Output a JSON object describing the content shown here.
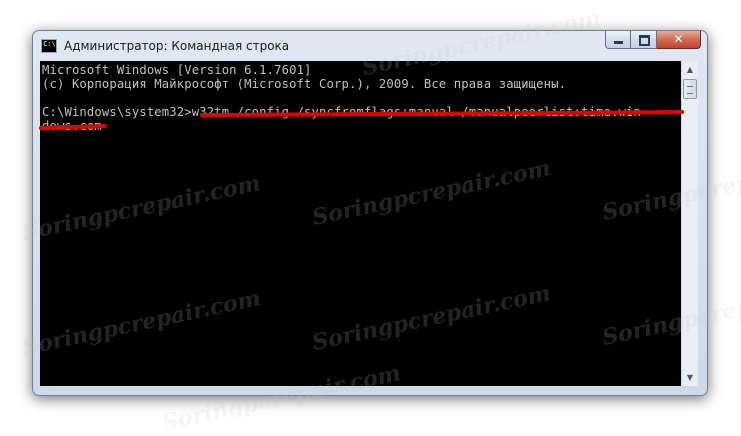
{
  "window": {
    "title": "Администратор: Командная строка",
    "icon_glyph": "C:\\",
    "close_glyph": "✕"
  },
  "console": {
    "lines": [
      "Microsoft Windows [Version 6.1.7601]",
      "(c) Корпорация Майкрософт (Microsoft Corp.), 2009. Все права защищены.",
      "",
      "C:\\Windows\\system32>w32tm /config /syncfromflags:manual /manualpeerlist:time.win",
      "dows.com"
    ]
  },
  "scrollbar": {
    "up_glyph": "▲",
    "down_glyph": "▼"
  },
  "watermark": "Soringpcrepair.com",
  "colors": {
    "console_bg": "#000000",
    "console_text": "#c0c0c0",
    "highlight": "#e00000"
  }
}
